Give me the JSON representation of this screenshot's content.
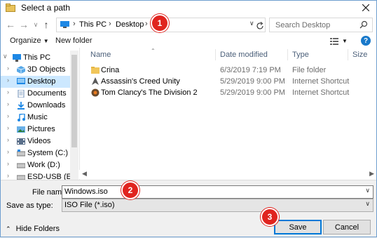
{
  "window": {
    "title": "Select a path"
  },
  "address": {
    "crumbs": [
      "This PC",
      "Desktop"
    ],
    "search_placeholder": "Search Desktop"
  },
  "toolbar": {
    "organize": "Organize",
    "new_folder": "New folder",
    "help": "?"
  },
  "nav": {
    "items": [
      {
        "label": "This PC",
        "icon": "pc-icon"
      },
      {
        "label": "3D Objects",
        "icon": "3d-objects-icon"
      },
      {
        "label": "Desktop",
        "icon": "desktop-folder-icon"
      },
      {
        "label": "Documents",
        "icon": "documents-icon"
      },
      {
        "label": "Downloads",
        "icon": "downloads-icon"
      },
      {
        "label": "Music",
        "icon": "music-icon"
      },
      {
        "label": "Pictures",
        "icon": "pictures-icon"
      },
      {
        "label": "Videos",
        "icon": "videos-icon"
      },
      {
        "label": "System (C:)",
        "icon": "drive-icon"
      },
      {
        "label": "Work (D:)",
        "icon": "drive-icon"
      },
      {
        "label": "ESD-USB (E:)",
        "icon": "usb-drive-icon"
      }
    ]
  },
  "list": {
    "headers": {
      "name": "Name",
      "date": "Date modified",
      "type": "Type",
      "size": "Size"
    },
    "rows": [
      {
        "name": "Crina",
        "date": "6/3/2019 7:19 PM",
        "type": "File folder",
        "icon": "folder-icon"
      },
      {
        "name": "Assassin's Creed Unity",
        "date": "5/29/2019 9:00 PM",
        "type": "Internet Shortcut",
        "icon": "game-shortcut-icon"
      },
      {
        "name": "Tom Clancy's The Division 2",
        "date": "5/29/2019 9:00 PM",
        "type": "Internet Shortcut",
        "icon": "game-shortcut-icon"
      }
    ]
  },
  "form": {
    "file_name_label": "File name:",
    "file_name_value": "Windows.iso",
    "save_type_label": "Save as type:",
    "save_type_value": "ISO File (*.iso)"
  },
  "footer": {
    "hide_folders": "Hide Folders",
    "save": "Save",
    "cancel": "Cancel"
  },
  "callouts": [
    "1",
    "2",
    "3"
  ],
  "colors": {
    "accent": "#0078d7",
    "selection": "#cce8ff",
    "callout": "#e0241f"
  }
}
